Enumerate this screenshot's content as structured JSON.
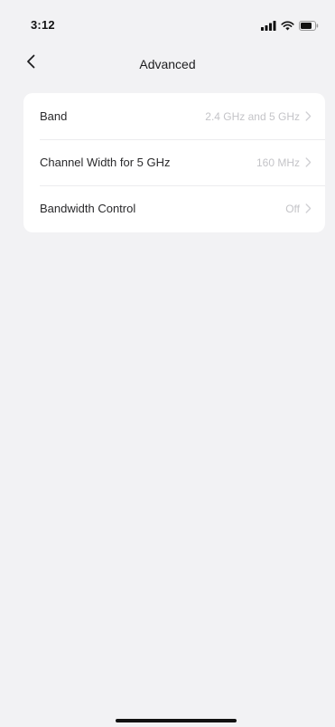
{
  "status_bar": {
    "time": "3:12",
    "icons": [
      "signal-icon",
      "wifi-icon",
      "battery-icon"
    ]
  },
  "nav": {
    "title": "Advanced",
    "back_icon": "chevron-left-icon"
  },
  "settings": {
    "rows": [
      {
        "label": "Band",
        "value": "2.4 GHz and 5 GHz"
      },
      {
        "label": "Channel Width for 5 GHz",
        "value": "160 MHz"
      },
      {
        "label": "Bandwidth Control",
        "value": "Off"
      }
    ]
  },
  "colors": {
    "background": "#f2f2f4",
    "card": "#ffffff",
    "value_text": "#c4c4c8",
    "divider": "#ececee"
  }
}
